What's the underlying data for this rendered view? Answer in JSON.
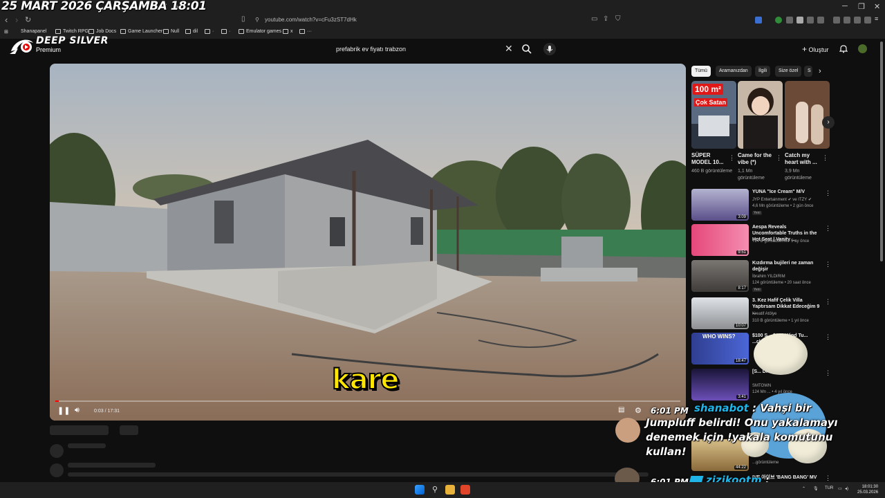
{
  "overlay": {
    "date_banner": "25 MART 2026 ÇARŞAMBA 18:01",
    "brand": "DEEP SILVER",
    "brand_sub": "Premium"
  },
  "browser": {
    "url": "youtube.com/watch?v=cFu3zST7dHk",
    "bookmarks": [
      "Shanapanel",
      "Twitch RPG",
      "Job Docs",
      "Game Launcher",
      "Null",
      "dil",
      "·",
      "·",
      "Emulator games",
      "x",
      "···"
    ]
  },
  "youtube": {
    "search_query": "prefabrik ev fiyatı trabzon",
    "create_label": "Oluştur"
  },
  "player": {
    "caption": "kare",
    "time_display": "0:03 / 17:31",
    "progress_fraction": 0.003
  },
  "chips": [
    "Tümü",
    "Aramanızdan",
    "İlgili",
    "Size özel",
    "S"
  ],
  "shorts": [
    {
      "title": "SÜPER MODEL 10...",
      "views": "460 B görüntüleme",
      "badge_top": "100 m²",
      "badge_mid": "Çok Satan"
    },
    {
      "title": "Came for the vibe (*)",
      "views": "1,1 Mn görüntüleme"
    },
    {
      "title": "Catch my heart with ...",
      "views": "3,9 Mn görüntüleme"
    }
  ],
  "videos": [
    {
      "title": "YUNA \"Ice Cream\" M/V",
      "channel": "JYP Entertainment ✔ ve ITZY ✔",
      "meta": "4,6 Mn görüntüleme • 2 gün önce",
      "duration": "3:09",
      "badge": "Yeni"
    },
    {
      "title": "Aespa Reveals Uncomfortable Truths in the Hot Seat | Vanity ...",
      "channel": "Vanity Fair ✔",
      "meta": "724 B görüntüleme • 5 ay önce",
      "duration": "9:51"
    },
    {
      "title": "Kızdırma bujileri ne zaman değişir",
      "channel": "İbrahim YILDIRIM",
      "meta": "124 görüntüleme • 20 saat önce",
      "duration": "8:17",
      "badge": "Yeni"
    },
    {
      "title": "3. Kez Hafif Çelik Villa Yaptırsam Dikkat Edeceğim 9 ...",
      "channel": "Kreatif Atölye",
      "meta": "310 B görüntüleme • 1 yıl önce",
      "duration": "10:07"
    },
    {
      "title": "$100 S... $100 Wind Tu... ...ckyard",
      "channel": "",
      "meta": "",
      "duration": "18:47",
      "thumb_text": "WHO WINS?"
    },
    {
      "title": "[S... Dre... ...V",
      "channel": "SMTOWN",
      "meta": "124 Mn ... • 4 yıl önce",
      "duration": "3:41"
    },
    {
      "title": "",
      "channel": "",
      "meta": "...görüntüleme",
      "duration": "44:22"
    },
    {
      "title": "IVE 아이브 'BANG BANG' MV",
      "channel": "",
      "meta": "",
      "duration": ""
    }
  ],
  "chat": [
    {
      "time": "6:01 PM",
      "user": "shanabot",
      "message": "Vahşi bir Jumpluff belirdi! Onu yakalamayı denemek için !yakala komutunu kullan!"
    },
    {
      "time": "6:01 PM",
      "user": "zizikootm",
      "message": ":"
    }
  ],
  "taskbar": {
    "lang": "TUR",
    "time": "18:01:30",
    "date": "25.03.2026"
  },
  "colors": {
    "background": "#0f0f0f",
    "accent_red": "#ff0000",
    "caption_yellow": "#ffe600",
    "chat_user_blue": "#1fb5e8"
  }
}
